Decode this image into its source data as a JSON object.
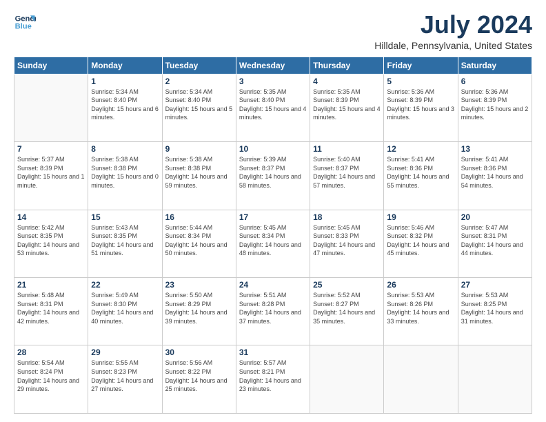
{
  "logo": {
    "line1": "General",
    "line2": "Blue"
  },
  "header": {
    "title": "July 2024",
    "subtitle": "Hilldale, Pennsylvania, United States"
  },
  "weekdays": [
    "Sunday",
    "Monday",
    "Tuesday",
    "Wednesday",
    "Thursday",
    "Friday",
    "Saturday"
  ],
  "weeks": [
    [
      {
        "day": "",
        "info": ""
      },
      {
        "day": "1",
        "info": "Sunrise: 5:34 AM\nSunset: 8:40 PM\nDaylight: 15 hours\nand 6 minutes."
      },
      {
        "day": "2",
        "info": "Sunrise: 5:34 AM\nSunset: 8:40 PM\nDaylight: 15 hours\nand 5 minutes."
      },
      {
        "day": "3",
        "info": "Sunrise: 5:35 AM\nSunset: 8:40 PM\nDaylight: 15 hours\nand 4 minutes."
      },
      {
        "day": "4",
        "info": "Sunrise: 5:35 AM\nSunset: 8:39 PM\nDaylight: 15 hours\nand 4 minutes."
      },
      {
        "day": "5",
        "info": "Sunrise: 5:36 AM\nSunset: 8:39 PM\nDaylight: 15 hours\nand 3 minutes."
      },
      {
        "day": "6",
        "info": "Sunrise: 5:36 AM\nSunset: 8:39 PM\nDaylight: 15 hours\nand 2 minutes."
      }
    ],
    [
      {
        "day": "7",
        "info": "Sunrise: 5:37 AM\nSunset: 8:39 PM\nDaylight: 15 hours\nand 1 minute."
      },
      {
        "day": "8",
        "info": "Sunrise: 5:38 AM\nSunset: 8:38 PM\nDaylight: 15 hours\nand 0 minutes."
      },
      {
        "day": "9",
        "info": "Sunrise: 5:38 AM\nSunset: 8:38 PM\nDaylight: 14 hours\nand 59 minutes."
      },
      {
        "day": "10",
        "info": "Sunrise: 5:39 AM\nSunset: 8:37 PM\nDaylight: 14 hours\nand 58 minutes."
      },
      {
        "day": "11",
        "info": "Sunrise: 5:40 AM\nSunset: 8:37 PM\nDaylight: 14 hours\nand 57 minutes."
      },
      {
        "day": "12",
        "info": "Sunrise: 5:41 AM\nSunset: 8:36 PM\nDaylight: 14 hours\nand 55 minutes."
      },
      {
        "day": "13",
        "info": "Sunrise: 5:41 AM\nSunset: 8:36 PM\nDaylight: 14 hours\nand 54 minutes."
      }
    ],
    [
      {
        "day": "14",
        "info": "Sunrise: 5:42 AM\nSunset: 8:35 PM\nDaylight: 14 hours\nand 53 minutes."
      },
      {
        "day": "15",
        "info": "Sunrise: 5:43 AM\nSunset: 8:35 PM\nDaylight: 14 hours\nand 51 minutes."
      },
      {
        "day": "16",
        "info": "Sunrise: 5:44 AM\nSunset: 8:34 PM\nDaylight: 14 hours\nand 50 minutes."
      },
      {
        "day": "17",
        "info": "Sunrise: 5:45 AM\nSunset: 8:34 PM\nDaylight: 14 hours\nand 48 minutes."
      },
      {
        "day": "18",
        "info": "Sunrise: 5:45 AM\nSunset: 8:33 PM\nDaylight: 14 hours\nand 47 minutes."
      },
      {
        "day": "19",
        "info": "Sunrise: 5:46 AM\nSunset: 8:32 PM\nDaylight: 14 hours\nand 45 minutes."
      },
      {
        "day": "20",
        "info": "Sunrise: 5:47 AM\nSunset: 8:31 PM\nDaylight: 14 hours\nand 44 minutes."
      }
    ],
    [
      {
        "day": "21",
        "info": "Sunrise: 5:48 AM\nSunset: 8:31 PM\nDaylight: 14 hours\nand 42 minutes."
      },
      {
        "day": "22",
        "info": "Sunrise: 5:49 AM\nSunset: 8:30 PM\nDaylight: 14 hours\nand 40 minutes."
      },
      {
        "day": "23",
        "info": "Sunrise: 5:50 AM\nSunset: 8:29 PM\nDaylight: 14 hours\nand 39 minutes."
      },
      {
        "day": "24",
        "info": "Sunrise: 5:51 AM\nSunset: 8:28 PM\nDaylight: 14 hours\nand 37 minutes."
      },
      {
        "day": "25",
        "info": "Sunrise: 5:52 AM\nSunset: 8:27 PM\nDaylight: 14 hours\nand 35 minutes."
      },
      {
        "day": "26",
        "info": "Sunrise: 5:53 AM\nSunset: 8:26 PM\nDaylight: 14 hours\nand 33 minutes."
      },
      {
        "day": "27",
        "info": "Sunrise: 5:53 AM\nSunset: 8:25 PM\nDaylight: 14 hours\nand 31 minutes."
      }
    ],
    [
      {
        "day": "28",
        "info": "Sunrise: 5:54 AM\nSunset: 8:24 PM\nDaylight: 14 hours\nand 29 minutes."
      },
      {
        "day": "29",
        "info": "Sunrise: 5:55 AM\nSunset: 8:23 PM\nDaylight: 14 hours\nand 27 minutes."
      },
      {
        "day": "30",
        "info": "Sunrise: 5:56 AM\nSunset: 8:22 PM\nDaylight: 14 hours\nand 25 minutes."
      },
      {
        "day": "31",
        "info": "Sunrise: 5:57 AM\nSunset: 8:21 PM\nDaylight: 14 hours\nand 23 minutes."
      },
      {
        "day": "",
        "info": ""
      },
      {
        "day": "",
        "info": ""
      },
      {
        "day": "",
        "info": ""
      }
    ]
  ]
}
